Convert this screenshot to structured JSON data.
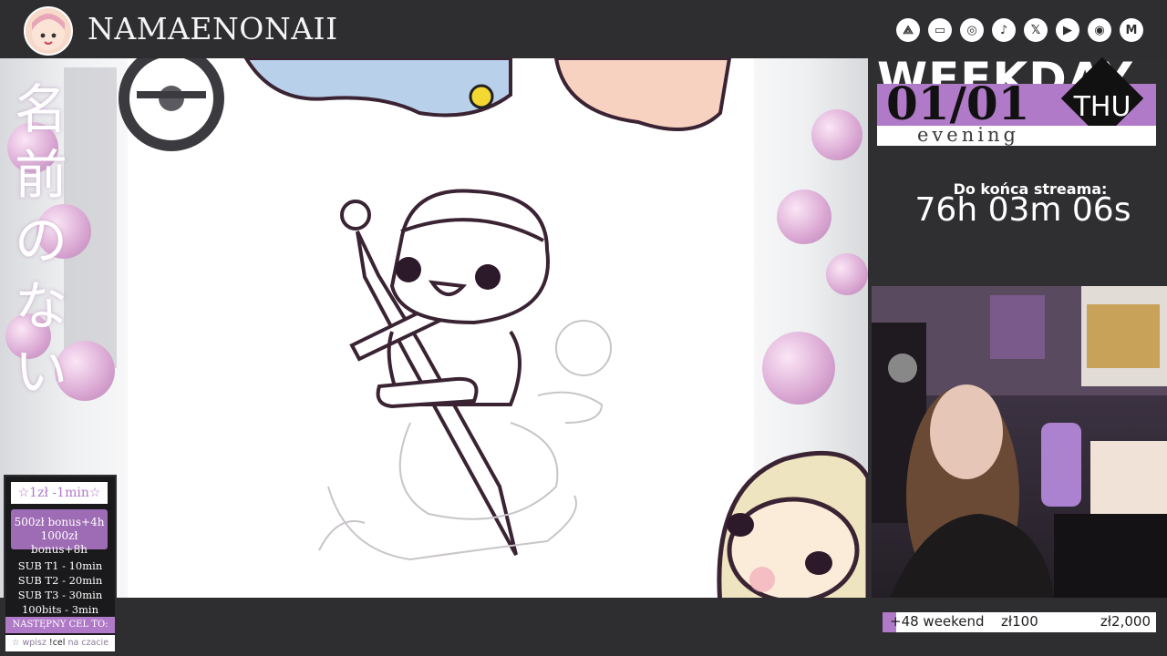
{
  "header": {
    "channel_name": "NAMAENONAII",
    "social_icons": [
      "linktree-icon",
      "twitch-icon",
      "instagram-icon",
      "tiktok-icon",
      "x-icon",
      "youtube-icon",
      "discord-icon",
      "mail-icon"
    ],
    "social_glyphs": [
      "⟁",
      "▭",
      "◎",
      "♪",
      "𝕏",
      "▶",
      "◉",
      "M"
    ]
  },
  "left_overlay": {
    "vertical_title": [
      "名",
      "前",
      "の",
      "な",
      "い"
    ]
  },
  "donation_panel": {
    "rate": "☆1zł -1min☆",
    "bonus_1": "500zł bonus+4h",
    "bonus_2": "1000zł bonus+8h",
    "subs": [
      "SUB T1 - 10min",
      "SUB T2 - 20min",
      "SUB T3 - 30min",
      "100bits - 3min"
    ],
    "next_goal": "NASTĘPNY CEL TO:",
    "command_prefix": "☆ wpisz",
    "command": "!cel",
    "command_suffix": "na czacie"
  },
  "sidebar": {
    "weekday": "WEEKDAY",
    "date": "01/01",
    "day": "THU",
    "time_of_day": "evening",
    "countdown_label": "Do końca streama:",
    "countdown": "76h 03m 06s"
  },
  "goal_bar": {
    "label": "+48 weekend",
    "mid": "zł100",
    "max": "zł2,000",
    "progress_fraction": 0.05
  },
  "colors": {
    "accent": "#b07ac8",
    "background": "#2e2d2f"
  }
}
